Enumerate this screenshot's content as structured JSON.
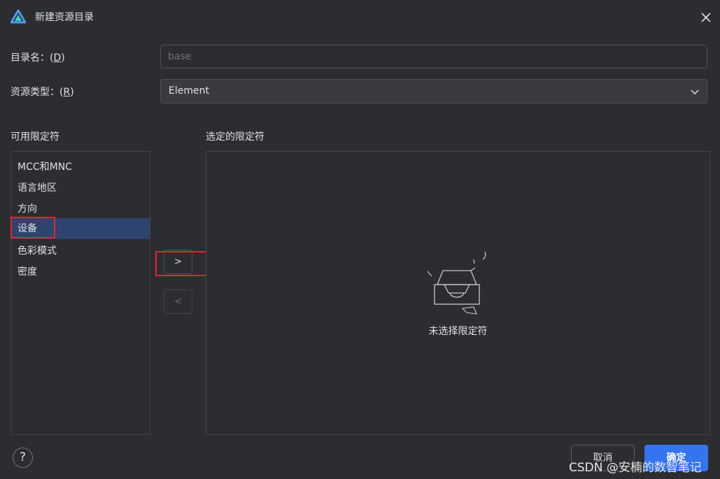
{
  "window": {
    "title": "新建资源目录",
    "logo_icon": "deveco-logo-icon",
    "close_icon": "close-icon"
  },
  "form": {
    "dir_name_label": "目录名：",
    "dir_name_mnemonic_open": "(",
    "dir_name_mnemonic": "D",
    "dir_name_mnemonic_close": ")",
    "dir_name_placeholder": "base",
    "dir_name_value": "",
    "res_type_label": "资源类型：",
    "res_type_mnemonic_open": "(",
    "res_type_mnemonic": "R",
    "res_type_mnemonic_close": ")",
    "res_type_value": "Element"
  },
  "available": {
    "header": "可用限定符",
    "items": [
      "MCC和MNC",
      "语言地区",
      "方向",
      "设备",
      "色彩模式",
      "密度"
    ],
    "selected_item": "设备"
  },
  "move_buttons": {
    "add_label": ">",
    "remove_label": "<"
  },
  "selected": {
    "header": "选定的限定符",
    "empty_text": "未选择限定符",
    "empty_icon": "empty-box-icon"
  },
  "footer": {
    "help_label": "?",
    "cancel_label": "取消",
    "ok_label": "确定"
  },
  "watermark": "CSDN @安楠的数智笔记",
  "colors": {
    "background": "#2b2d30",
    "selection": "#2e436e",
    "primary_button": "#3574f0",
    "annotation_red": "#e8242b"
  }
}
